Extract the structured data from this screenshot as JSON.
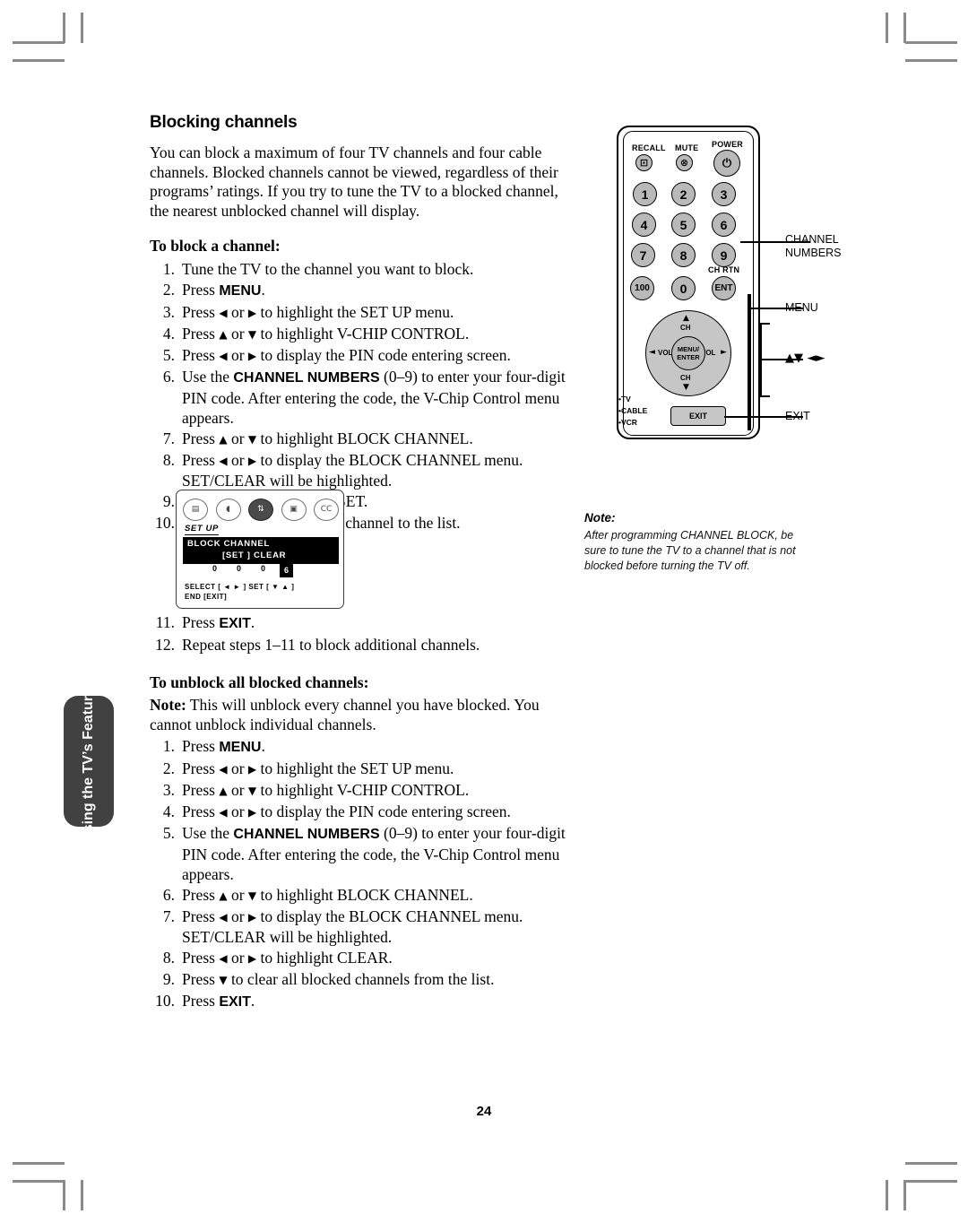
{
  "page": {
    "number": "24"
  },
  "side_tab": {
    "label": "Using the TV’s Features"
  },
  "content": {
    "section_title": "Blocking channels",
    "intro": "You can block a maximum of four TV channels and four cable channels. Blocked channels cannot be viewed, regardless of their programs’ ratings. If you try to tune the TV to a blocked channel, the nearest unblocked channel will display.",
    "block_heading": "To block a channel:",
    "block_steps": [
      {
        "num": "1.",
        "html": "Tune the TV to the channel you want to block."
      },
      {
        "num": "2.",
        "html": "Press <span class=\"kbd\">MENU</span>."
      },
      {
        "num": "3.",
        "html": "Press <span class=\"arw\">&#9664;</span> or <span class=\"arw\">&#9654;</span> to highlight the SET UP menu."
      },
      {
        "num": "4.",
        "html": "Press <span class=\"arw\">&#9650;</span> or <span class=\"arw\">&#9660;</span> to highlight V-CHIP CONTROL."
      },
      {
        "num": "5.",
        "html": "Press <span class=\"arw\">&#9664;</span> or <span class=\"arw\">&#9654;</span> to display the PIN code entering screen."
      },
      {
        "num": "6.",
        "html": "Use the <span class=\"kbd\">CHANNEL NUMBERS</span> (0&#8211;9) to enter your four-digit PIN code. After entering the code, the V-Chip Control menu appears."
      },
      {
        "num": "7.",
        "html": "Press <span class=\"arw\">&#9650;</span> or <span class=\"arw\">&#9660;</span> to highlight BLOCK CHANNEL."
      },
      {
        "num": "8.",
        "html": "Press <span class=\"arw\">&#9664;</span> or <span class=\"arw\">&#9654;</span> to display the BLOCK CHANNEL menu. SET/CLEAR will be highlighted."
      },
      {
        "num": "9.",
        "html": "Press <span class=\"arw\">&#9664;</span> or <span class=\"arw\">&#9654;</span> to highlight SET."
      },
      {
        "num": "10.",
        "html": "Press <span class=\"arw\">&#9660;</span> to add the current channel to the list."
      }
    ],
    "block_steps_after": [
      {
        "num": "11.",
        "html": "Press <span class=\"kbd\">EXIT</span>."
      },
      {
        "num": "12.",
        "html": "Repeat steps 1&#8211;11 to block additional channels."
      }
    ],
    "unblock_heading": "To unblock all blocked channels:",
    "unblock_note": "<b>Note:</b> This will unblock every channel you have blocked. You cannot unblock individual channels.",
    "unblock_steps": [
      {
        "num": "1.",
        "html": "Press <span class=\"kbd\">MENU</span>."
      },
      {
        "num": "2.",
        "html": "Press <span class=\"arw\">&#9664;</span> or <span class=\"arw\">&#9654;</span> to highlight the SET UP menu."
      },
      {
        "num": "3.",
        "html": "Press <span class=\"arw\">&#9650;</span> or <span class=\"arw\">&#9660;</span> to highlight V-CHIP CONTROL."
      },
      {
        "num": "4.",
        "html": "Press <span class=\"arw\">&#9664;</span> or <span class=\"arw\">&#9654;</span> to display the PIN code entering screen."
      },
      {
        "num": "5.",
        "html": "Use the <span class=\"kbd\">CHANNEL NUMBERS</span> (0&#8211;9) to enter your four-digit PIN code. After entering the code, the V-Chip Control menu appears."
      },
      {
        "num": "6.",
        "html": "Press <span class=\"arw\">&#9650;</span> or <span class=\"arw\">&#9660;</span> to highlight BLOCK CHANNEL."
      },
      {
        "num": "7.",
        "html": "Press <span class=\"arw\">&#9664;</span> or <span class=\"arw\">&#9654;</span> to display the BLOCK CHANNEL menu. SET/CLEAR will be highlighted."
      },
      {
        "num": "8.",
        "html": "Press <span class=\"arw\">&#9664;</span> or <span class=\"arw\">&#9654;</span> to highlight CLEAR."
      },
      {
        "num": "9.",
        "html": "Press <span class=\"arw\">&#9660;</span> to clear all blocked channels from the list."
      },
      {
        "num": "10.",
        "html": "Press <span class=\"kbd\">EXIT</span>."
      }
    ]
  },
  "osd": {
    "icons": [
      {
        "name": "picture-icon",
        "glyph": "▤",
        "selected": false
      },
      {
        "name": "audio-icon",
        "glyph": "◖",
        "selected": false
      },
      {
        "name": "setup-icon",
        "glyph": "⇅",
        "selected": true
      },
      {
        "name": "video-icon",
        "glyph": "▣",
        "selected": false
      },
      {
        "name": "closed-caption-icon",
        "glyph": "CC",
        "selected": false
      }
    ],
    "menu_label": "SET UP",
    "row_title": "BLOCK CHANNEL",
    "set_clear": "[SET ] CLEAR",
    "pin_digits": [
      "0",
      "0",
      "0",
      "6"
    ],
    "pin_highlight_index": 3,
    "footer_line1": "SELECT [ ◄ ► ]   SET [ ▼ ▲ ]",
    "footer_line2": "END [EXIT]"
  },
  "note": {
    "title": "Note:",
    "body": "After programming CHANNEL BLOCK, be sure to tune the TV to a channel that is not blocked before turning the TV off."
  },
  "remote": {
    "top_labels": {
      "recall": "RECALL",
      "mute": "MUTE",
      "power": "POWER"
    },
    "keys": {
      "recall_glyph": "⊡",
      "mute_glyph": "⊗",
      "power_glyph": "⏻",
      "k1": "1",
      "k2": "2",
      "k3": "3",
      "k4": "4",
      "k5": "5",
      "k6": "6",
      "k7": "7",
      "k8": "8",
      "k9": "9",
      "k100": "100",
      "k0": "0",
      "kent": "ENT",
      "ch_rtn": "CH RTN"
    },
    "dpad": {
      "ch_up": "CH",
      "ch_down": "CH",
      "vol_left": "VOL",
      "vol_right": "VOL",
      "center_line1": "MENU/",
      "center_line2": "ENTER",
      "up_tri": "▲",
      "down_tri": "▼",
      "left_tri": "◄",
      "right_tri": "►"
    },
    "source_dots": [
      "TV",
      "CABLE",
      "VCR"
    ],
    "exit_key": "EXIT",
    "callouts": {
      "channel_numbers_line1": "CHANNEL",
      "channel_numbers_line2": "NUMBERS",
      "menu": "MENU",
      "arrows": "▲▼ ◄►",
      "exit": "EXIT"
    }
  }
}
